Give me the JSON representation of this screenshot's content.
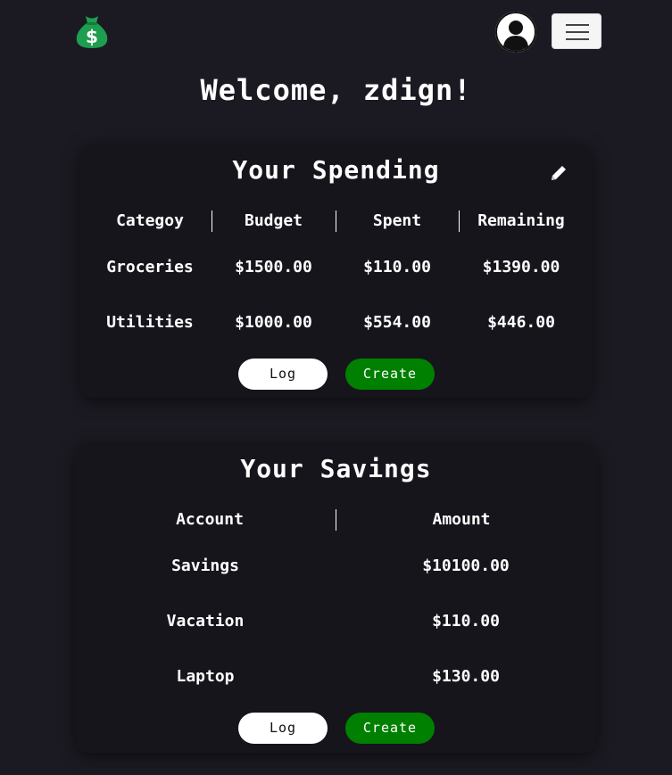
{
  "nav": {
    "logo_icon": "money-bag-icon",
    "avatar_icon": "user-avatar-icon",
    "menu_icon": "hamburger-menu-icon"
  },
  "welcome": "Welcome, zdign!",
  "spending": {
    "title": "Your Spending",
    "edit_icon": "pencil-icon",
    "headers": [
      "Categoy",
      "Budget",
      "Spent",
      "Remaining"
    ],
    "rows": [
      [
        "Groceries",
        "$1500.00",
        "$110.00",
        "$1390.00"
      ],
      [
        "Utilities",
        "$1000.00",
        "$554.00",
        "$446.00"
      ]
    ],
    "log_label": "Log",
    "create_label": "Create"
  },
  "savings": {
    "title": "Your Savings",
    "headers": [
      "Account",
      "Amount"
    ],
    "rows": [
      [
        "Savings",
        "$10100.00"
      ],
      [
        "Vacation",
        "$110.00"
      ],
      [
        "Laptop",
        "$130.00"
      ]
    ],
    "log_label": "Log",
    "create_label": "Create"
  },
  "colors": {
    "background": "#1b1a22",
    "card": "#16151c",
    "create_button": "#008000",
    "logo_green": "#1e9e4f"
  }
}
